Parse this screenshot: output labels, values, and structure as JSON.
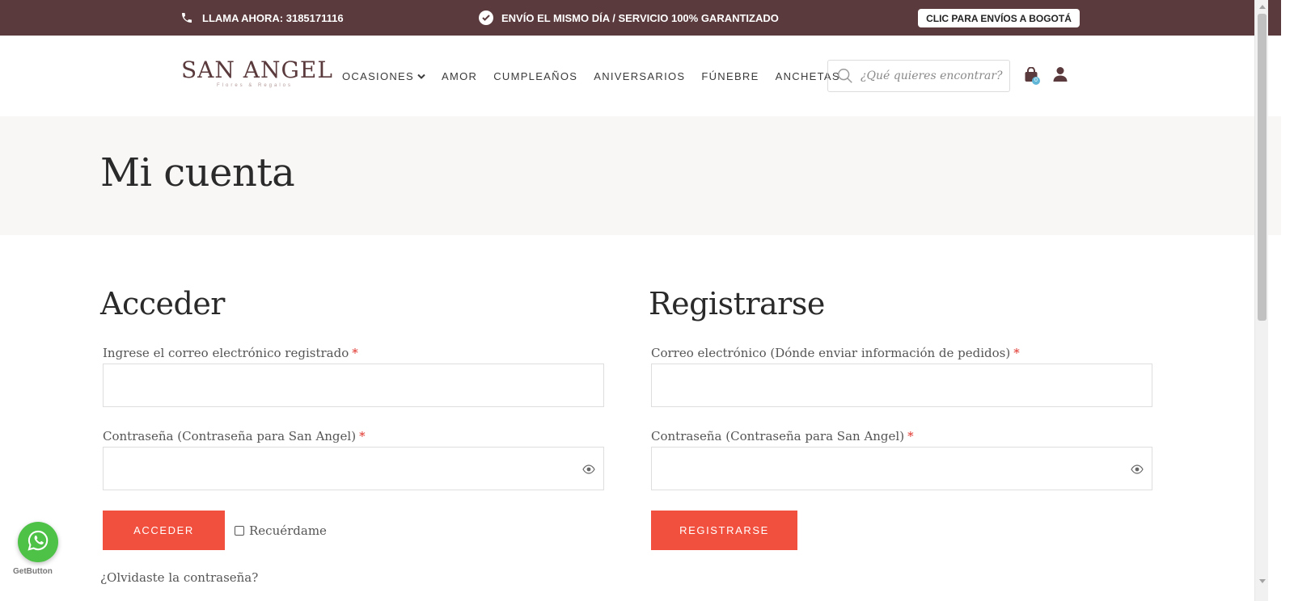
{
  "topbar": {
    "call_text": "LLAMA AHORA: 3185171116",
    "shipping_text": "ENVÍO EL MISMO DÍA / SERVICIO 100% GARANTIZADO",
    "bogota_button": "CLIC PARA ENVÍOS A BOGOTÁ",
    "background": "#5a3a3c"
  },
  "header": {
    "logo_text": "SAN ANGEL",
    "logo_subtext": "Flores & Regalos",
    "nav": [
      {
        "label": "OCASIONES",
        "has_dropdown": true
      },
      {
        "label": "AMOR"
      },
      {
        "label": "CUMPLEAÑOS"
      },
      {
        "label": "ANIVERSARIOS"
      },
      {
        "label": "FÚNEBRE"
      },
      {
        "label": "ANCHETAS"
      }
    ],
    "search_placeholder": "¿Qué quieres encontrar?",
    "cart_count": "0",
    "icons": {
      "search": "search-icon",
      "cart": "shopping-bag-icon",
      "account": "user-icon"
    }
  },
  "page": {
    "title": "Mi cuenta"
  },
  "login": {
    "heading": "Acceder",
    "email_label": "Ingrese el correo electrónico registrado",
    "password_label": "Contraseña (Contraseña para San Angel)",
    "required_mark": "*",
    "submit_label": "ACCEDER",
    "remember_label": "Recuérdame",
    "forgot_label": "¿Olvidaste la contraseña?"
  },
  "register": {
    "heading": "Registrarse",
    "email_label": "Correo electrónico (Dónde enviar información de pedidos)",
    "password_label": "Contraseña (Contraseña para San Angel)",
    "required_mark": "*",
    "submit_label": "REGISTRARSE"
  },
  "widget": {
    "label": "GetButton",
    "icon": "whatsapp-icon"
  },
  "colors": {
    "accent": "#f2503e",
    "brand": "#5a3a3c",
    "title_band": "#f8f7f5",
    "required": "#e0342c"
  }
}
